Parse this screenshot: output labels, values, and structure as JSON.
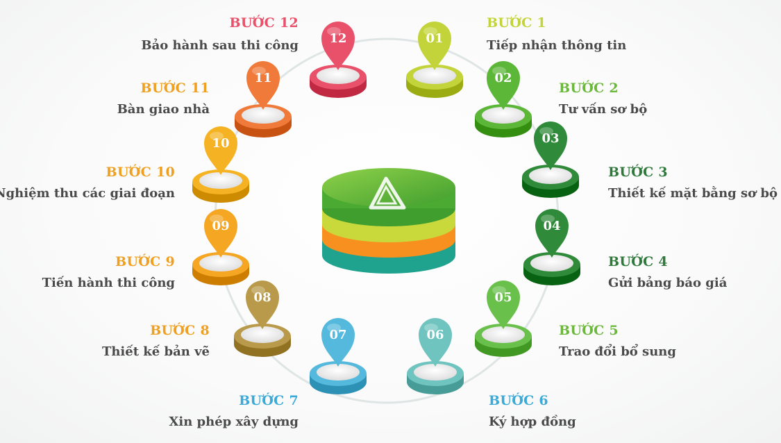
{
  "colors": {
    "step1": "#c3d43a",
    "step2": "#5cb638",
    "step3": "#2f8a3a",
    "step4": "#2f8a3a",
    "step5": "#69c04a",
    "step6": "#6fc4c0",
    "step7": "#55b8dd",
    "step8": "#b89a4a",
    "step9": "#f5a623",
    "step10": "#f5b324",
    "step11": "#f07a3a",
    "step12": "#e9506a",
    "label12": "#e9506a",
    "label11": "#f0a020",
    "label10": "#f0a020",
    "label9": "#f0a020",
    "label8": "#f0a020",
    "label7": "#3aaad8",
    "label6": "#3aaad8",
    "label5": "#6cb83c",
    "label4": "#2f7a3a",
    "label3": "#2f7a3a",
    "label2": "#6cb83c",
    "label1": "#c3d43a"
  },
  "center": {
    "logo": "triangle-swirl-icon"
  },
  "steps": [
    {
      "num": "01",
      "label": "BƯỚC 1",
      "desc": "Tiếp nhận thông tin"
    },
    {
      "num": "02",
      "label": "BƯỚC 2",
      "desc": "Tư vấn sơ bộ"
    },
    {
      "num": "03",
      "label": "BƯỚC 3",
      "desc": "Thiết kế mặt bằng sơ bộ"
    },
    {
      "num": "04",
      "label": "BƯỚC 4",
      "desc": "Gửi bảng báo giá"
    },
    {
      "num": "05",
      "label": "BƯỚC 5",
      "desc": "Trao đổi bổ sung"
    },
    {
      "num": "06",
      "label": "BƯỚC 6",
      "desc": "Ký hợp đồng"
    },
    {
      "num": "07",
      "label": "BƯỚC 7",
      "desc": "Xin phép xây dựng"
    },
    {
      "num": "08",
      "label": "BƯỚC 8",
      "desc": "Thiết kế bản vẽ"
    },
    {
      "num": "09",
      "label": "BƯỚC 9",
      "desc": "Tiến hành thi công"
    },
    {
      "num": "10",
      "label": "BƯỚC 10",
      "desc": "Nghiệm thu các giai đoạn"
    },
    {
      "num": "11",
      "label": "BƯỚC 11",
      "desc": "Bàn giao nhà"
    },
    {
      "num": "12",
      "label": "BƯỚC 12",
      "desc": "Bảo hành sau thi công"
    }
  ]
}
